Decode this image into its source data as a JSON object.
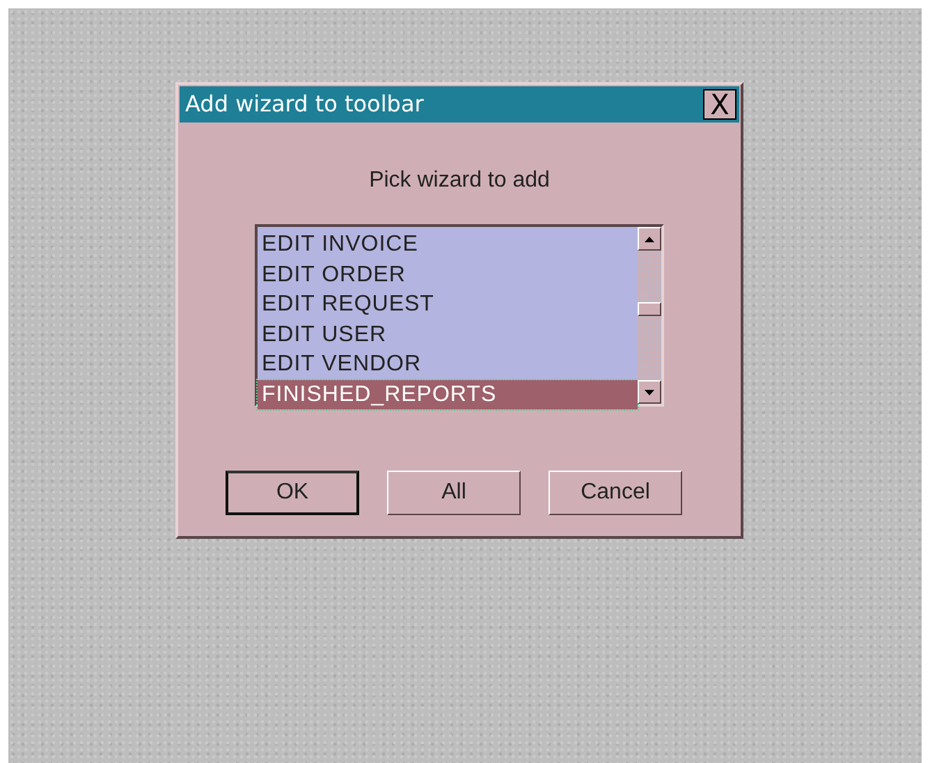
{
  "window": {
    "title": "Add wizard to toolbar",
    "close": "X"
  },
  "prompt": "Pick wizard to add",
  "list": {
    "items": [
      {
        "label": "EDIT INVOICE",
        "selected": false
      },
      {
        "label": "EDIT ORDER",
        "selected": false
      },
      {
        "label": "EDIT REQUEST",
        "selected": false
      },
      {
        "label": "EDIT USER",
        "selected": false
      },
      {
        "label": "EDIT VENDOR",
        "selected": false
      },
      {
        "label": "FINISHED_REPORTS",
        "selected": true
      }
    ]
  },
  "buttons": [
    {
      "label": "OK",
      "default": true
    },
    {
      "label": "All",
      "default": false
    },
    {
      "label": "Cancel",
      "default": false
    }
  ]
}
